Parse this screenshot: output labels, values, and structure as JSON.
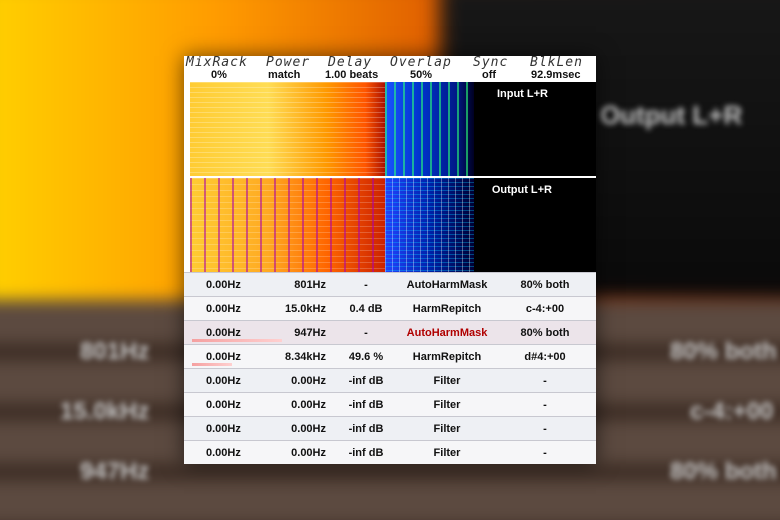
{
  "background": {
    "output_label": "Output L+R",
    "row_values": [
      "801Hz",
      "15.0kHz",
      "947Hz"
    ],
    "right_values": [
      "80% both",
      "c-4:+00",
      "80% both"
    ]
  },
  "header": {
    "labels": [
      "MixRack",
      "Power",
      "Delay",
      "Overlap",
      "Sync",
      "BlkLen"
    ],
    "values": [
      "0%",
      "match",
      "1.00 beats",
      "50%",
      "off",
      "92.9msec"
    ]
  },
  "spectrograms": {
    "input_label": "Input L+R",
    "output_label": "Output L+R"
  },
  "rows": [
    {
      "low": "0.00Hz",
      "high": "801Hz",
      "gain": "-",
      "type": "AutoHarmMask",
      "param": "80% both",
      "level": 0.0
    },
    {
      "low": "0.00Hz",
      "high": "15.0kHz",
      "gain": "0.4 dB",
      "type": "HarmRepitch",
      "param": "c-4:+00",
      "level": 0.0
    },
    {
      "low": "0.00Hz",
      "high": "947Hz",
      "gain": "-",
      "type": "AutoHarmMask",
      "param": "80% both",
      "level": 0.45,
      "selected": true
    },
    {
      "low": "0.00Hz",
      "high": "8.34kHz",
      "gain": "49.6 %",
      "type": "HarmRepitch",
      "param": "d#4:+00",
      "level": 0.2
    },
    {
      "low": "0.00Hz",
      "high": "0.00Hz",
      "gain": "-inf dB",
      "type": "Filter",
      "param": "-",
      "level": 0.0
    },
    {
      "low": "0.00Hz",
      "high": "0.00Hz",
      "gain": "-inf dB",
      "type": "Filter",
      "param": "-",
      "level": 0.0
    },
    {
      "low": "0.00Hz",
      "high": "0.00Hz",
      "gain": "-inf dB",
      "type": "Filter",
      "param": "-",
      "level": 0.0
    },
    {
      "low": "0.00Hz",
      "high": "0.00Hz",
      "gain": "-inf dB",
      "type": "Filter",
      "param": "-",
      "level": 0.0
    }
  ],
  "colors": {
    "selected_text": "#b00000",
    "meter": "#f5a0a0"
  }
}
